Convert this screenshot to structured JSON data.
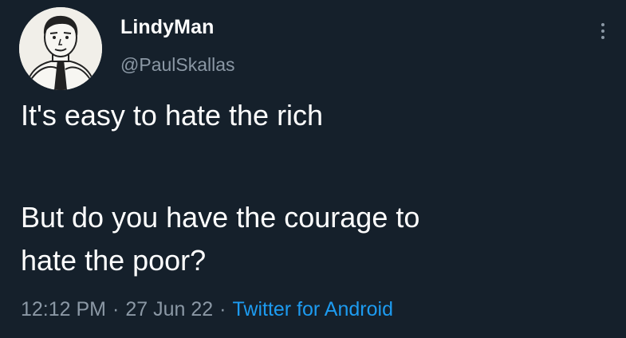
{
  "user": {
    "display_name": "LindyMan",
    "handle": "@PaulSkallas"
  },
  "tweet": {
    "lines": [
      "It's easy to hate the rich",
      "But do you have the courage to",
      "hate the poor?"
    ],
    "time": "12:12 PM",
    "date": "27 Jun 22",
    "separator": "·",
    "source": "Twitter for Android"
  },
  "icons": {
    "more": "more-vertical-icon",
    "avatar": "cartoon-man-avatar"
  },
  "colors": {
    "background": "#15202b",
    "text": "#ffffff",
    "muted": "#8b98a5",
    "link": "#1d9bf0"
  }
}
